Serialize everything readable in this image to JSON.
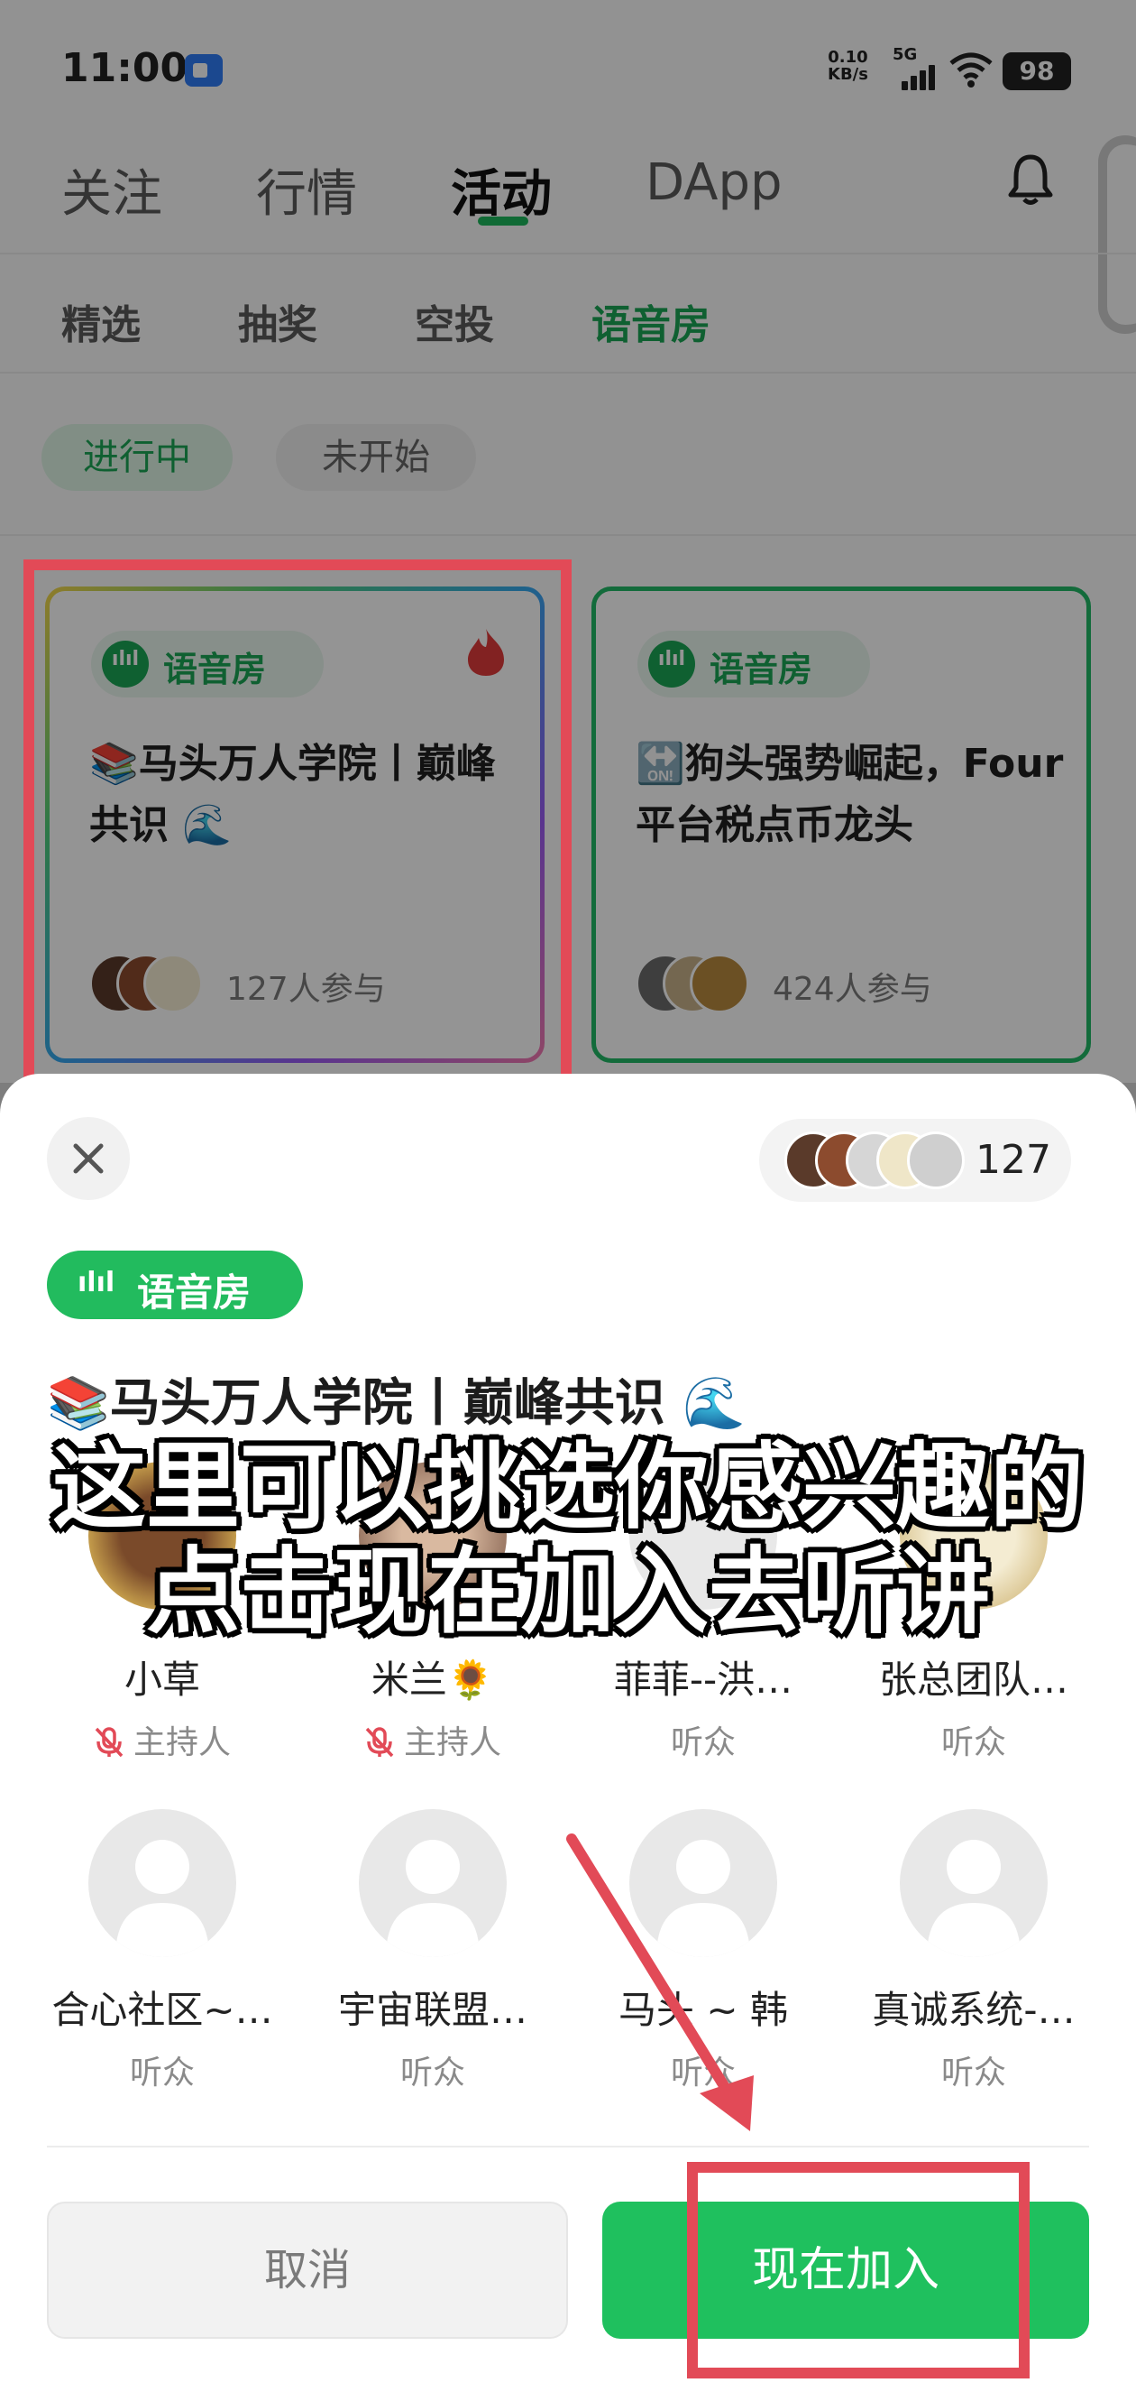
{
  "status_bar": {
    "time": "11:00",
    "net_speed_value": "0.10",
    "net_speed_unit": "KB/s",
    "network": "5G",
    "battery": "98"
  },
  "top_tabs": [
    "关注",
    "行情",
    "活动",
    "DApp"
  ],
  "top_tab_active": "活动",
  "sub_tabs": [
    "精选",
    "抽奖",
    "空投",
    "语音房"
  ],
  "sub_tab_active": "语音房",
  "filters": {
    "active": "进行中",
    "idle": "未开始"
  },
  "rooms": [
    {
      "tag": "语音房",
      "title": "📚马头万人学院丨巅峰共识 🌊",
      "participants": "127人参与"
    },
    {
      "tag": "语音房",
      "title": "🔛狗头强势崛起，Four平台税点币龙头",
      "participants": "424人参与"
    }
  ],
  "sheet": {
    "member_count": "127",
    "tag": "语音房",
    "title": "📚马头万人学院丨巅峰共识 🌊",
    "speakers": [
      {
        "name": "小草",
        "role": "主持人",
        "muted": true
      },
      {
        "name": "米兰🌻",
        "role": "主持人",
        "muted": true
      },
      {
        "name": "菲菲--洪…",
        "role": "听众",
        "muted": false
      },
      {
        "name": "张总团队…",
        "role": "听众",
        "muted": false
      },
      {
        "name": "合心社区~…",
        "role": "听众",
        "muted": false
      },
      {
        "name": "宇宙联盟…",
        "role": "听众",
        "muted": false
      },
      {
        "name": "马头 ~ 韩",
        "role": "听众",
        "muted": false
      },
      {
        "name": "真诚系统-…",
        "role": "听众",
        "muted": false
      }
    ],
    "cancel_label": "取消",
    "join_label": "现在加入"
  },
  "caption": {
    "line1": "这里可以挑选你感兴趣的",
    "line2": "点击现在加入去听讲"
  },
  "colors": {
    "brand_green": "#1fc05e",
    "annotation_red": "#e24a57"
  }
}
